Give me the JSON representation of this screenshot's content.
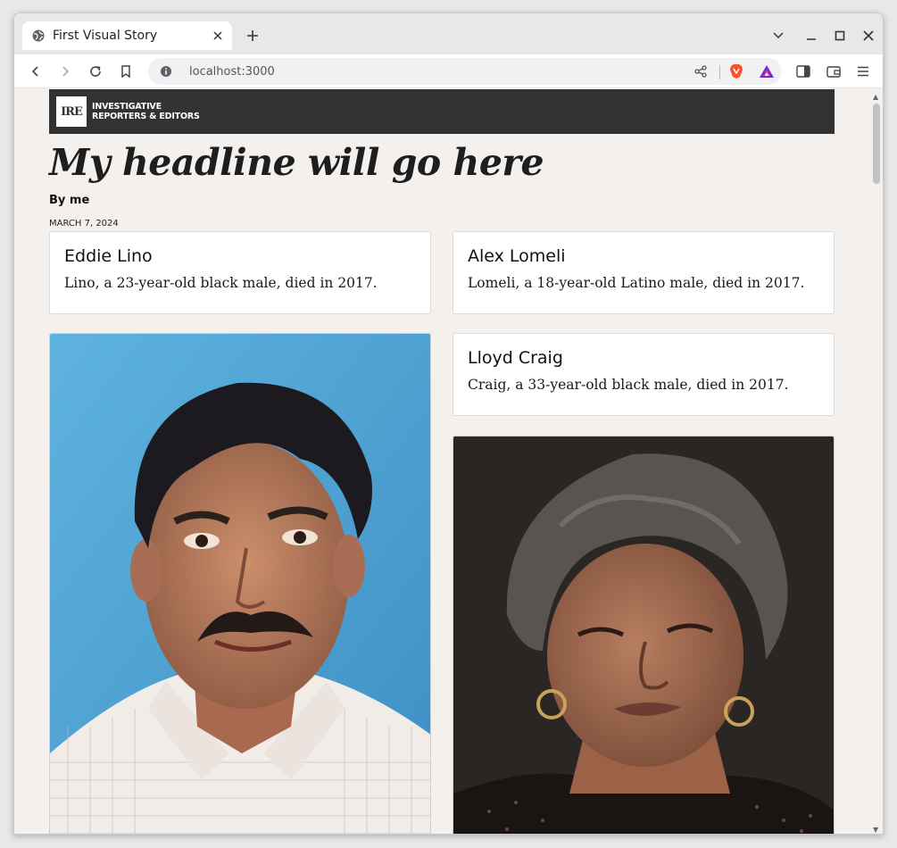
{
  "browser": {
    "tab_title": "First Visual Story",
    "url": "localhost:3000"
  },
  "site": {
    "logo_text": "IRE",
    "org_line1": "INVESTIGATIVE",
    "org_line2": "REPORTERS & EDITORS"
  },
  "article": {
    "headline": "My headline will go here",
    "byline": "By me",
    "date": "MARCH 7, 2024"
  },
  "cards": [
    {
      "name": "Eddie Lino",
      "description": "Lino, a 23-year-old black male, died in 2017."
    },
    {
      "name": "Alex Lomeli",
      "description": "Lomeli, a 18-year-old Latino male, died in 2017."
    },
    {
      "name": "Lloyd Craig",
      "description": "Craig, a 33-year-old black male, died in 2017."
    }
  ],
  "colors": {
    "masthead": "#333232",
    "page_background": "#f3f0ed",
    "brave_orange": "#fb542b"
  }
}
